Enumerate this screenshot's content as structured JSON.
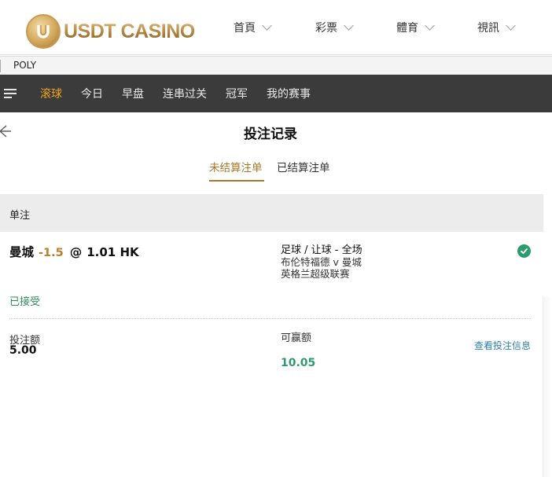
{
  "header": {
    "logo_text": "USDT CASINO",
    "nav": [
      {
        "label": "首頁"
      },
      {
        "label": "彩票"
      },
      {
        "label": "體育"
      },
      {
        "label": "視訊"
      }
    ]
  },
  "provider": {
    "label": "POLY"
  },
  "sport_tabs": [
    {
      "label": "滚球",
      "active": true
    },
    {
      "label": "今日",
      "active": false
    },
    {
      "label": "早盘",
      "active": false
    },
    {
      "label": "连串过关",
      "active": false
    },
    {
      "label": "冠军",
      "active": false
    },
    {
      "label": "我的赛事",
      "active": false
    }
  ],
  "page": {
    "title": "投注记录"
  },
  "subtabs": [
    {
      "label": "未结算注单",
      "active": true
    },
    {
      "label": "已结算注单",
      "active": false
    }
  ],
  "section": {
    "label": "单注"
  },
  "bet": {
    "selection": "曼城",
    "handicap": "-1.5",
    "at": "@",
    "odds": "1.01 HK",
    "market": "足球 / 让球 - 全场",
    "match": "布伦特福德 v 曼城",
    "league": "英格兰超级联赛",
    "status": "已接受",
    "stake_label": "投注额",
    "stake_value": "5.00",
    "win_label": "可赢额",
    "win_value": "10.05",
    "view_info": "查看投注信息"
  },
  "colors": {
    "brand_gold": "#a87a2a",
    "active_tab": "#f2a41e",
    "handicap": "#b8802a",
    "win_green": "#2e9b6e",
    "link_blue": "#2f7fb0",
    "dark_bar": "#3b3b3b"
  },
  "icons": {
    "logo": "usdt-coin-icon",
    "nav_chevron": "chevron-down-icon",
    "menu": "hamburger-menu-icon",
    "back": "back-arrow-icon",
    "status": "check-circle-icon"
  }
}
